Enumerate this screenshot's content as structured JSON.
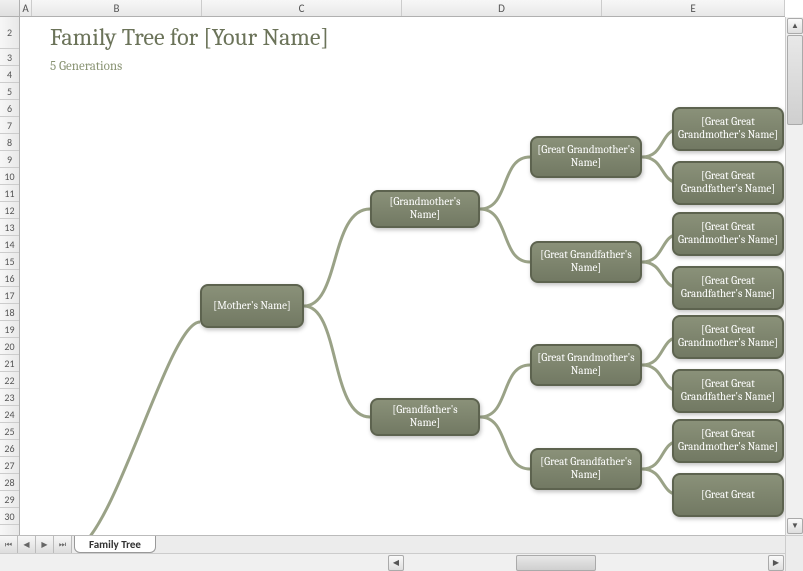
{
  "columns": [
    "A",
    "B",
    "C",
    "D",
    "E"
  ],
  "rows": [
    "2",
    "3",
    "4",
    "5",
    "6",
    "7",
    "8",
    "9",
    "10",
    "11",
    "12",
    "13",
    "14",
    "15",
    "16",
    "17",
    "18",
    "19",
    "20",
    "21",
    "22",
    "23",
    "24",
    "25",
    "26",
    "27",
    "28",
    "29",
    "30"
  ],
  "title": "Family Tree for [Your Name]",
  "subtitle": "5 Generations",
  "tab": "Family Tree",
  "tree": {
    "mother": "[Mother's Name]",
    "grandmother": "[Grandmother's Name]",
    "grandfather": "[Grandfather's Name]",
    "ggm1": "[Great Grandmother's Name]",
    "ggf1": "[Great Grandfather's Name]",
    "ggm2": "[Great Grandmother's Name]",
    "ggf2": "[Great Grandfather's Name]",
    "gggm1": "[Great Great Grandmother's Name]",
    "gggf1": "[Great Great Grandfather's Name]",
    "gggm2": "[Great Great Grandmother's Name]",
    "gggf2": "[Great Great Grandfather's Name]",
    "gggm3": "[Great Great Grandmother's Name]",
    "gggf3": "[Great Great Grandfather's Name]",
    "gggm4": "[Great Great Grandmother's Name]"
  }
}
